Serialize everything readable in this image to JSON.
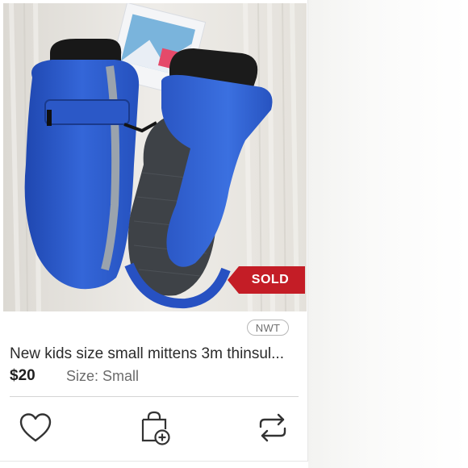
{
  "listing": {
    "sold_label": "SOLD",
    "condition_badge": "NWT",
    "title": "New kids size small mittens 3m thinsul...",
    "price": "$20",
    "size_label": "Size:",
    "size_value": "Small"
  },
  "actions": {
    "like_icon": "heart-icon",
    "bag_icon": "add-to-bag-icon",
    "share_icon": "share-icon"
  },
  "colors": {
    "sold_tag": "#c41d26",
    "mitten_blue": "#2f5fd0",
    "text_primary": "#2b2b2b",
    "text_secondary": "#6b6b6b"
  }
}
